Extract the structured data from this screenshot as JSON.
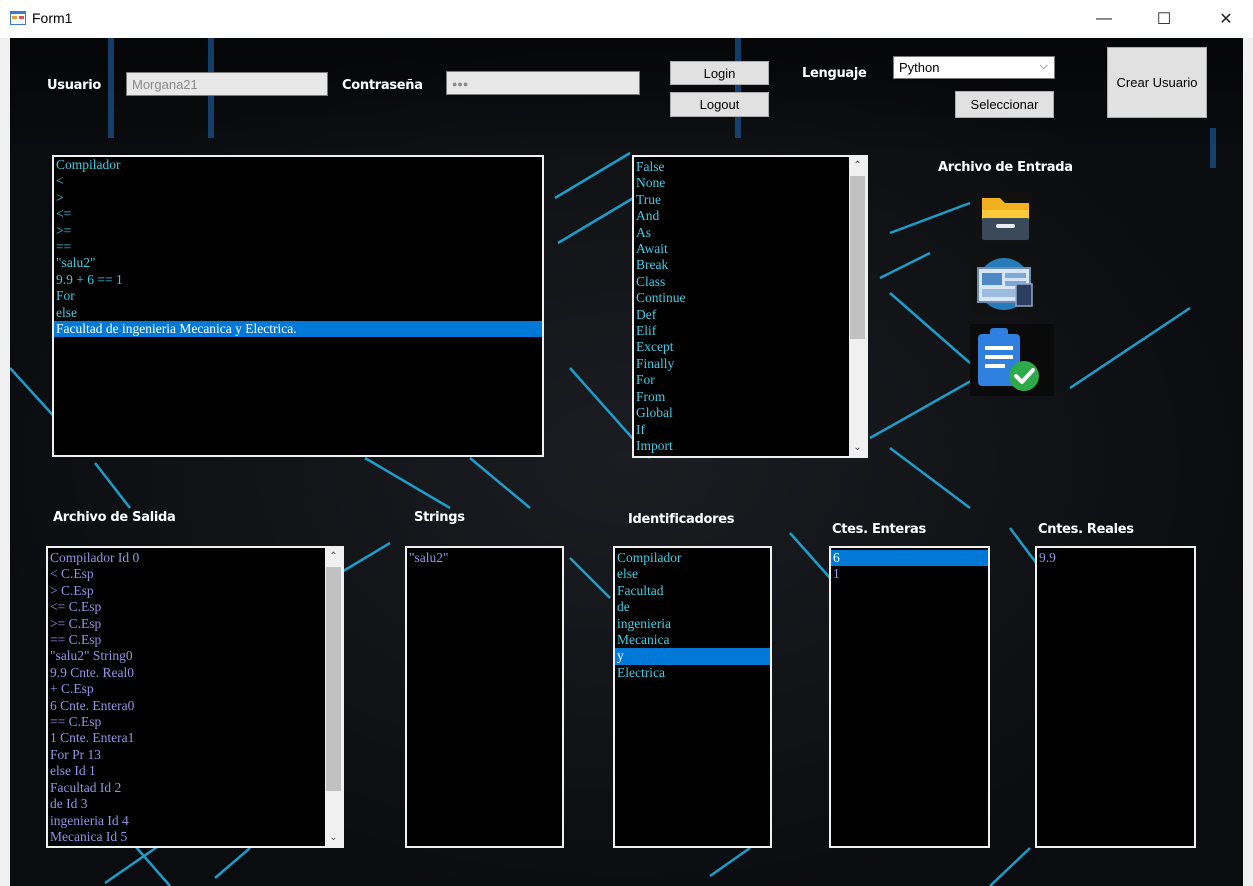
{
  "window": {
    "title": "Form1",
    "minimize": "—",
    "maximize": "☐",
    "close": "✕"
  },
  "header": {
    "usuario_label": "Usuario",
    "usuario_value": "Morgana21",
    "contrasena_label": "Contraseña",
    "contrasena_value": "●●●",
    "login": "Login",
    "logout": "Logout",
    "lenguaje_label": "Lenguaje",
    "lenguaje_selected": "Python",
    "seleccionar": "Seleccionar",
    "crear_usuario": "Crear Usuario"
  },
  "input_list": {
    "items": [
      "Compilador",
      "<",
      ">",
      "<=",
      ">=",
      "==",
      "\"salu2\"",
      "9.9 + 6 == 1",
      "For",
      "else",
      "Facultad de ingenieria Mecanica y Electrica."
    ],
    "selected_index": 10
  },
  "keywords_list": {
    "items": [
      "False",
      "None",
      "True",
      "And",
      "As",
      "Await",
      "Break",
      "Class",
      "Continue",
      "Def",
      "Elif",
      "Except",
      "Finally",
      "For",
      "From",
      "Global",
      "If",
      "Import"
    ]
  },
  "archivo_entrada": {
    "label": "Archivo de Entrada",
    "icons": [
      "folder-icon",
      "screen-icon",
      "clipboard-check-icon"
    ]
  },
  "salida": {
    "label": "Archivo de Salida",
    "items": [
      "Compilador Id  0",
      "< C.Esp",
      "> C.Esp",
      "<= C.Esp",
      ">= C.Esp",
      "== C.Esp",
      "\"salu2\" String0",
      "9.9 Cnte. Real0",
      "+ C.Esp",
      "6 Cnte. Entera0",
      "== C.Esp",
      "1 Cnte. Entera1",
      "For  Pr  13",
      "else Id  1",
      "Facultad Id  2",
      "de Id  3",
      "ingenieria Id  4",
      "Mecanica Id  5"
    ]
  },
  "strings": {
    "label": "Strings",
    "items": [
      "\"salu2\""
    ]
  },
  "identificadores": {
    "label": "Identificadores",
    "items": [
      "Compilador",
      "else",
      "Facultad",
      "de",
      "ingenieria",
      "Mecanica",
      "y",
      "Electrica"
    ],
    "selected_index": 6
  },
  "enteras": {
    "label": "Ctes. Enteras",
    "items": [
      "6",
      "1"
    ],
    "selected_index": 0
  },
  "reales": {
    "label": "Cntes. Reales",
    "items": [
      "9.9"
    ]
  },
  "colors": {
    "selection": "#0078d7",
    "cyan_text": "#38d0e8",
    "purple_text": "#9a92e8",
    "accent_lines": "#1fb6ea"
  }
}
